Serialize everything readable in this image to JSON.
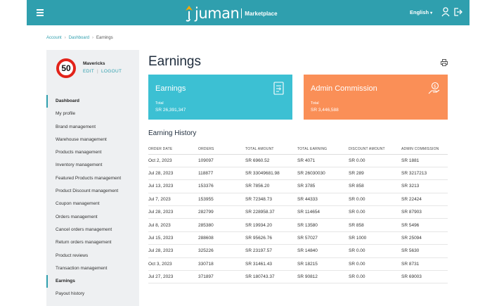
{
  "header": {
    "logo_text": "juman",
    "logo_sub": "Marketplace",
    "language": "English",
    "colors": {
      "bar": "#2f9fae",
      "logo_accent": "#f6a800"
    },
    "icons": [
      "menu-icon",
      "user-icon",
      "logout-icon"
    ]
  },
  "breadcrumb": [
    "Account",
    "Dashboard",
    "Earnings"
  ],
  "profile": {
    "badge": "50",
    "name": "Mavericks",
    "edit": "EDIT",
    "logout": "LOGOUT"
  },
  "sidebar": {
    "items": [
      "Dashboard",
      "My profile",
      "Brand management",
      "Warehouse management",
      "Products management",
      "Inventory management",
      "Featured Products management",
      "Product Discount management",
      "Coupon management",
      "Orders management",
      "Cancel orders management",
      "Return orders management",
      "Product reviews",
      "Transaction management",
      "Earnings",
      "Payout history"
    ],
    "active": [
      "Dashboard",
      "Earnings"
    ]
  },
  "main": {
    "title": "Earnings",
    "cards": {
      "earnings": {
        "title": "Earnings",
        "label": "Total",
        "value": "SR 26,391,347",
        "color": "#3cc0d3"
      },
      "commission": {
        "title": "Admin Commission",
        "label": "Total",
        "value": "SR 3,446,588",
        "color": "#fa8f57"
      }
    },
    "history_title": "Earning History",
    "table": {
      "headers": [
        "ORDER DATE",
        "ORDERS",
        "TOTAL AMOUNT",
        "TOTAL EARNING",
        "DISCOUNT AMOUNT",
        "ADMIN COMMISSION"
      ],
      "rows": [
        [
          "Oct 2, 2023",
          "109097",
          "SR 6960.52",
          "SR 4071",
          "SR 0.00",
          "SR 1881"
        ],
        [
          "Jul 28, 2023",
          "118877",
          "SR 33049681.98",
          "SR 26030030",
          "SR 289",
          "SR 3217213"
        ],
        [
          "Jul 13, 2023",
          "153376",
          "SR 7856.20",
          "SR 3785",
          "SR 858",
          "SR 3213"
        ],
        [
          "Jul 7, 2023",
          "153955",
          "SR 72348.73",
          "SR 44333",
          "SR 0.00",
          "SR 22424"
        ],
        [
          "Jul 28, 2023",
          "282799",
          "SR 228958.37",
          "SR 114654",
          "SR 0.00",
          "SR 87903"
        ],
        [
          "Jul 8, 2023",
          "285380",
          "SR 19934.20",
          "SR 13580",
          "SR 858",
          "SR 5496"
        ],
        [
          "Jul 15, 2023",
          "288608",
          "SR 95626.76",
          "SR 57027",
          "SR 1000",
          "SR 25094"
        ],
        [
          "Jul 28, 2023",
          "325226",
          "SR 23197.57",
          "SR 14840",
          "SR 0.00",
          "SR 5630"
        ],
        [
          "Oct 3, 2023",
          "330718",
          "SR 31461.43",
          "SR 18215",
          "SR 0.00",
          "SR 8731"
        ],
        [
          "Jul 27, 2023",
          "371897",
          "SR 180743.37",
          "SR 90812",
          "SR 0.00",
          "SR 69003"
        ]
      ]
    }
  }
}
